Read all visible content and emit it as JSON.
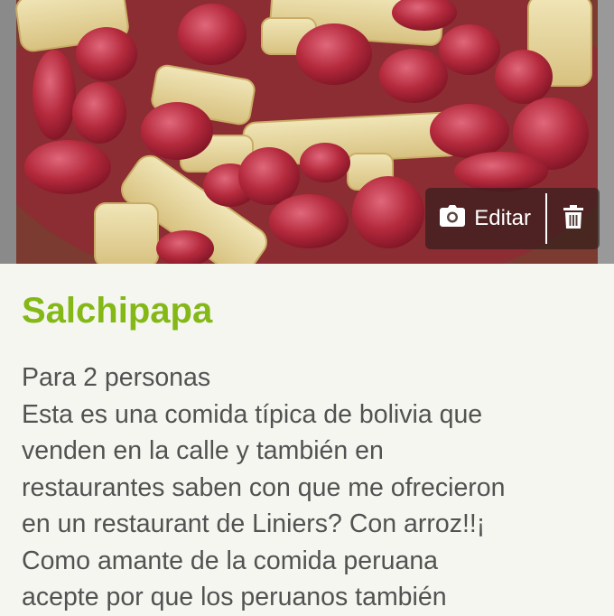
{
  "recipe": {
    "title": "Salchipapa",
    "description_lines": [
      "Para 2 personas",
      "Esta es una comida típica de bolivia que",
      "venden en la calle y también en",
      "restaurantes saben con que me ofrecieron",
      "en un restaurant de Liniers? Con arroz!!¡",
      "Como amante de la comida peruana",
      "acepte por que los peruanos también"
    ]
  },
  "photo_actions": {
    "edit_label": "Editar",
    "edit_icon": "camera-icon",
    "delete_icon": "trash-icon"
  },
  "colors": {
    "title": "#84b817",
    "text": "#525252",
    "background": "#f6f6f1"
  }
}
